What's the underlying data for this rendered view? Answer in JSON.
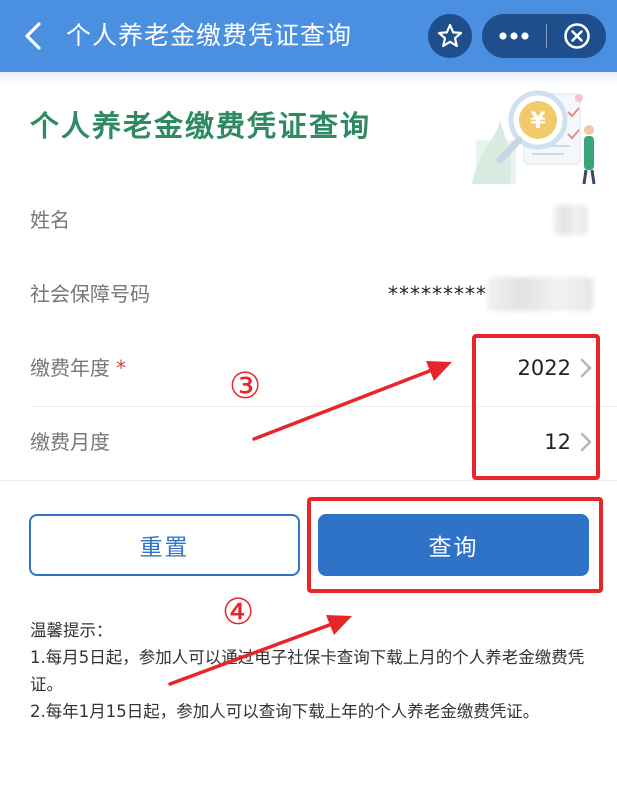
{
  "topbar": {
    "title": "个人养老金缴费凭证查询",
    "icons": [
      "back-icon",
      "star-icon",
      "more-icon",
      "close-circle-icon"
    ],
    "bg_color": "#4a8fe0",
    "capsule_color": "#1f4e8c"
  },
  "header": {
    "page_title": "个人养老金缴费凭证查询",
    "title_color": "#2e8a63",
    "illustration": "yuan-magnifier-illustration"
  },
  "form": {
    "name": {
      "label": "姓名",
      "value": ""
    },
    "ssn": {
      "label": "社会保障号码",
      "masked_value": "*********"
    },
    "year": {
      "label": "缴费年度",
      "required_mark": "*",
      "value": "2022"
    },
    "month": {
      "label": "缴费月度",
      "value": "12"
    }
  },
  "buttons": {
    "reset_label": "重置",
    "query_label": "查询",
    "primary_color": "#2f73c9"
  },
  "tips": {
    "heading": "温馨提示：",
    "line1": "1.每月5日起，参加人可以通过电子社保卡查询下载上月的个人养老金缴费凭证。",
    "line2": "2.每年1月15日起，参加人可以查询下载上年的个人养老金缴费凭证。"
  },
  "annotations": {
    "step3": "③",
    "step4": "④",
    "color": "#e8252a"
  }
}
